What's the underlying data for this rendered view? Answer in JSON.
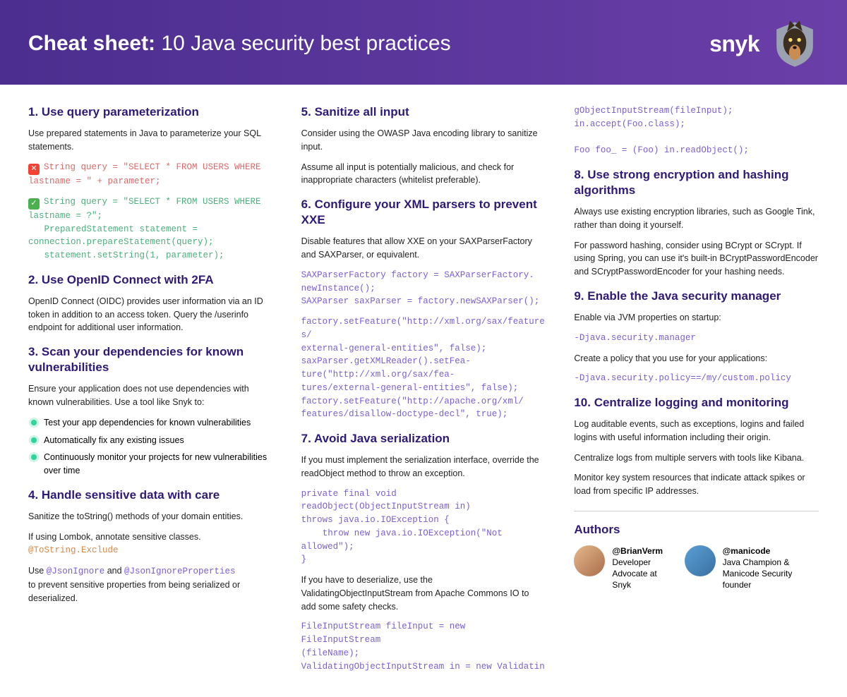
{
  "header": {
    "title_bold": "Cheat sheet:",
    "title_rest": " 10 Java security best practices",
    "brand": "snyk"
  },
  "col1": {
    "h1": "1. Use query parameterization",
    "p1": "Use prepared statements in Java to parameterize your SQL statements.",
    "code_bad": "String query = \"SELECT * FROM USERS WHERE lastname = \" + parameter;",
    "code_good": "String query = \"SELECT * FROM USERS WHERE lastname = ?\";\n   PreparedStatement statement = connection.prepareStatement(query);\n   statement.setString(1, parameter);",
    "h2": "2. Use OpenID Connect with 2FA",
    "p2": "OpenID Connect (OIDC) provides user information via an ID token in addition to an access token. Query the /userinfo endpoint for additional user information.",
    "h3": "3. Scan your dependencies for known vulnerabilities",
    "p3": "Ensure your application does not use dependencies with known vulnerabilities. Use a tool like Snyk to:",
    "b1": "Test your app dependencies for known vulnerabilities",
    "b2": "Automatically fix any existing issues",
    "b3": "Continuously monitor your projects for new vulnerabilities over time",
    "h4": "4. Handle sensitive data with care",
    "p4": "Sanitize the toString() methods of your domain entities.",
    "p5a": "If using Lombok, annotate sensitive classes. ",
    "p5b": "@ToString.Exclude",
    "p6a": "Use ",
    "p6b": "@JsonIgnore",
    "p6c": " and ",
    "p6d": "@JsonIgnoreProperties",
    "p6e": "to prevent sensitive properties from being serialized or deserialized."
  },
  "col2": {
    "h5": "5. Sanitize all input",
    "p5": "Consider using the OWASP Java encoding library to sanitize input.",
    "p5b": "Assume all input is potentially malicious, and check for inappropriate characters (whitelist preferable).",
    "h6": "6. Configure your XML parsers to prevent XXE",
    "p6": "Disable features that allow XXE on your SAXParserFactory and SAXParser, or equivalent.",
    "code6a": "SAXParserFactory factory = SAXParserFactory.\nnewInstance();\nSAXParser saxParser = factory.newSAXParser();",
    "code6b": "factory.setFeature(\"http://xml.org/sax/features/\nexternal-general-entities\", false);\nsaxParser.getXMLReader().setFea-\nture(\"http://xml.org/sax/fea-\ntures/external-general-entities\", false);\nfactory.setFeature(\"http://apache.org/xml/\nfeatures/disallow-doctype-decl\", true);",
    "h7": "7. Avoid Java serialization",
    "p7": "If you must implement the serialization interface, override the readObject method to throw an exception.",
    "code7": "private final void readObject(ObjectInputStream in)\nthrows java.io.IOException {\n    throw new java.io.IOException(\"Not allowed\");\n}",
    "p7b": "If you have to deserialize, use the ValidatingObjectInputStream from Apache Commons IO to add some safety checks.",
    "code7b": "FileInputStream fileInput = new FileInputStream\n(fileName);\nValidatingObjectInputStream in = new Validatin"
  },
  "col3": {
    "code7c": "gObjectInputStream(fileInput);\nin.accept(Foo.class);\n\nFoo foo_ = (Foo) in.readObject();",
    "h8": "8. Use strong encryption and hashing algorithms",
    "p8": "Always use existing encryption libraries, such as Google Tink, rather than doing it yourself.",
    "p8b": "For password hashing, consider using BCrypt or SCrypt. If using Spring, you can use it's built-in BCryptPasswordEncoder and SCryptPasswordEncoder for your hashing needs.",
    "h9": "9. Enable the Java security manager",
    "p9": "Enable via JVM properties on startup:",
    "code9a": "-Djava.security.manager",
    "p9b": "Create a policy that you use for your applications:",
    "code9b": "-Djava.security.policy==/my/custom.policy",
    "h10": "10. Centralize logging and monitoring",
    "p10": "Log auditable events, such as exceptions, logins and failed logins with useful information including their origin.",
    "p10b": "Centralize logs from multiple servers with tools like Kibana.",
    "p10c": "Monitor key system resources that indicate attack spikes or load from specific IP addresses.",
    "authors_title": "Authors",
    "author1_handle": "@BrianVerm",
    "author1_role": "Developer Advocate at Snyk",
    "author2_handle": "@manicode",
    "author2_role": "Java Champion & Manicode Security founder"
  }
}
